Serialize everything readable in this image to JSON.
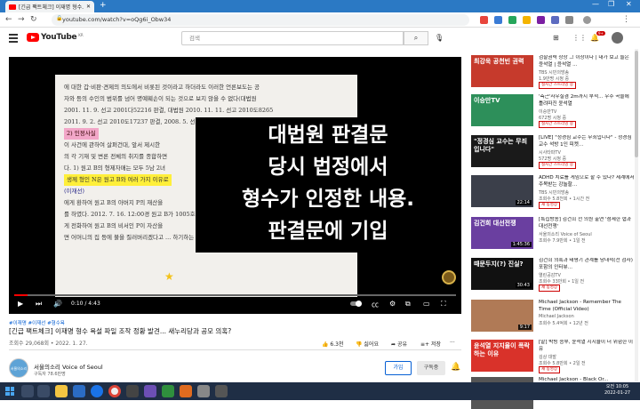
{
  "browser": {
    "tab_title": "[긴급 팩트체크] 이재명 형수...",
    "new_tab": "+",
    "url": "youtube.com/watch?v=oQg6i_Obw34"
  },
  "youtube": {
    "logo_text": "YouTube",
    "logo_region": "KR",
    "search_placeholder": "검색",
    "notif_count": "9+"
  },
  "player": {
    "doc_lines": [
      "에 대한 갑·비판·견제의 의도에서 비롯된 것이라고 하더라도 이러한 언론보도는 공",
      "자와 등의 수인의 범위를 넘어 명예훼손이 되는 것으로 보지 않을 수 없다(대법원",
      "2001. 11. 9. 선고 2001다52216 판결, 대법원 2010. 11. 11. 선고 2010도8265",
      "2011. 9. 2. 선고 2010도17237 판결, 2008. 5. 선고 2008도53805 판결 등 참조)",
      "2) 인정사실",
      "이 사건에 관하여 살펴건대, 앞서 제시한",
      "의 각 기재 및 변론 전체의 취지를 종합하면",
      "다. 1) 원고 B의 형제자매는 모두 5남 2녀",
      "생께 형인 N은 원고 B와 여러 가지 이유로",
      "(이재선)",
      "에게 환하여 원고 B의 아버지 P의 재산을",
      "를 하였다. 2012. 7. 16. 12:00경 원고 B가 1005호",
      "게 전화하여 원고 B의 비서인 P이 자산을",
      "면 어머니의 집 등에 불을 질러버리겠다고 ... 하기하는 등 폭행까지 하였다"
    ],
    "caption_lines": [
      "대법원 판결문",
      "당시 법정에서",
      "형수가 인정한 내용.",
      "판결문에 기입"
    ],
    "progress": 0.03,
    "time": "0:10 / 4:43"
  },
  "video": {
    "tags": "#이재명 #이재선 #형수욕",
    "title": "[긴급 팩트체크] 이재명 형수 욕설 파일 조작 정황 발견... 새누리당과 공모 의혹?",
    "meta": "조회수 29,068회 • 2022. 1. 27.",
    "likes": "6.3천",
    "dislike": "싫어요",
    "share": "공유",
    "save": "저장",
    "more": "···"
  },
  "channel": {
    "name": "서울의소리 Voice of Seoul",
    "avatar_text": "서울의소리",
    "subscribers": "구독자 78.6만명",
    "join": "가입",
    "subscribe": "구독중"
  },
  "recommendations": [
    {
      "thumb_text": "최강욱 공천빈 권력",
      "title": "검찰권력 상상 그 이상이다 | 내가 보고 들은 윤석열 | 윤석열 ...",
      "channel": "TBS 시민의방송",
      "meta": "1.9만명 시청 중",
      "live": "실시간 스트리밍 중",
      "bg": "#c63a2c"
    },
    {
      "thumb_text": "이승만TV",
      "title": "'측근'사우실겸 2m까지 부적... 우주 곡을에 틀려따진 윤석열",
      "channel": "이승만TV",
      "meta": "672명 시청 중",
      "live": "실시간 스트리밍 중",
      "bg": "#2d8f5a"
    },
    {
      "thumb_text": "\"정경심 교수는 무죄입니다\"",
      "title": "[LIVE] \"정경심 교수는 무죄입니다\" - 정경심 교수 석방 1인 피켓...",
      "channel": "시사타파TV",
      "meta": "572명 시청 중",
      "live": "실시간 스트리밍 중",
      "bg": "#1a1a1a"
    },
    {
      "thumb_text": "",
      "title": "ADHD 치료를 게임으로 할 수 있다? 세계에서 주목받는 강놀할...",
      "channel": "TBS 시민의방송",
      "meta": "조회수 5.8천회 • 1시간 전",
      "live": "새 동영상",
      "dur": "22:14",
      "bg": "#3b3f4a"
    },
    {
      "thumb_text": "김건희 대선전쟁",
      "title": "[특집방송] 김건희 전 의원 출연 '섬세한 협과 대선전쟁'",
      "channel": "서울의소리 Voice of Seoul",
      "meta": "조회수 7.9만회 • 1일 전",
      "live": "",
      "dur": "1:45:36",
      "bg": "#6a3fa0"
    },
    {
      "thumb_text": "때문두지(?) 진실?",
      "title": "김건희 의혹과 태평기 관계를 당대적(전 검사) 포함의 인터뷰...",
      "channel": "열린공감TV",
      "meta": "조회수 33만회 • 1일 전",
      "live": "새 동영상",
      "dur": "30:43",
      "bg": "#111"
    },
    {
      "thumb_text": "",
      "title": "Michael Jackson - Remember The Time (Official Video)",
      "channel": "Michael Jackson",
      "meta": "조회수 5.4억회 • 12년 전",
      "live": "",
      "dur": "9:17",
      "bg": "#b07a56"
    },
    {
      "thumb_text": "윤석열 지지율이 폭락하는 이유",
      "title": "[말] 박빙 승부, 윤석열 지지율이 더 위험한 이유",
      "channel": "김상 대발",
      "meta": "조회수 5.8만회 • 2일 전",
      "live": "새 동영상",
      "dur": "",
      "bg": "#d9322a"
    },
    {
      "thumb_text": "",
      "title": "Michael Jackson - Black Or...",
      "channel": "",
      "meta": "",
      "live": "",
      "dur": "",
      "bg": "#555"
    }
  ],
  "taskbar": {
    "time": "오전 10:05",
    "date": "2022-01-27"
  }
}
